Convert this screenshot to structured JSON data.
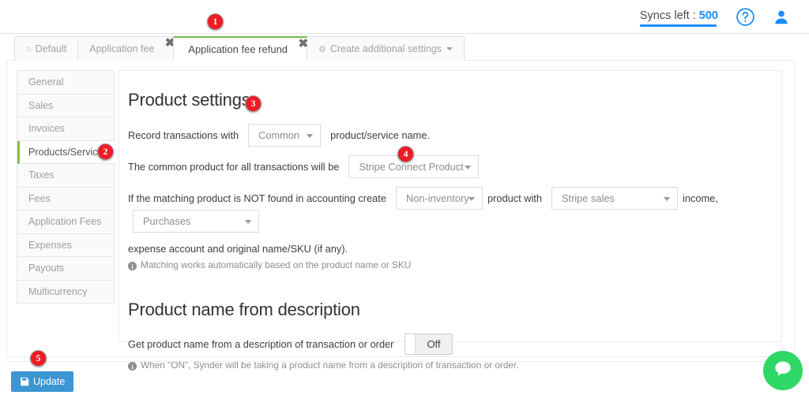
{
  "header": {
    "syncs_label": "Syncs left : ",
    "syncs_value": "500",
    "help_icon": "question-circle-icon",
    "user_icon": "user-avatar-icon",
    "accent_blue": "#1a8cff"
  },
  "tabs": [
    {
      "label": "Default",
      "icon": "home-icon",
      "closable": false,
      "active": false
    },
    {
      "label": "Application fee",
      "icon": "",
      "closable": true,
      "active": false
    },
    {
      "label": "Application fee refund",
      "icon": "",
      "closable": true,
      "active": true
    },
    {
      "label": "Create additional settings",
      "icon": "gear-icon",
      "closable": false,
      "active": false,
      "caret": true
    }
  ],
  "tab_close_glyph": "✖",
  "sidebar": {
    "items": [
      {
        "label": "General",
        "active": false
      },
      {
        "label": "Sales",
        "active": false
      },
      {
        "label": "Invoices",
        "active": false
      },
      {
        "label": "Products/Services",
        "active": true
      },
      {
        "label": "Taxes",
        "active": false
      },
      {
        "label": "Fees",
        "active": false
      },
      {
        "label": "Application Fees",
        "active": false
      },
      {
        "label": "Expenses",
        "active": false
      },
      {
        "label": "Payouts",
        "active": false
      },
      {
        "label": "Multicurrency",
        "active": false
      }
    ],
    "active_accent": "#7cc242"
  },
  "product_settings": {
    "heading": "Product settings",
    "row1": {
      "pre": "Record transactions with",
      "select_value": "Common",
      "post": "product/service name."
    },
    "row2": {
      "pre": "The common product for all transactions will be",
      "select_value": "Stripe Connect Product"
    },
    "row3": {
      "pre": "If the matching product is NOT found in accounting create",
      "type_select": "Non-inventory",
      "mid1": "product with",
      "income_select": "Stripe sales",
      "mid2": "income,",
      "account_select": "Purchases",
      "line2": "expense account and original name/SKU (if any)."
    },
    "hint": "Matching works automatically based on the product name or SKU"
  },
  "product_name_section": {
    "heading": "Product name from description",
    "toggle_label_text": "Get product name from a description of transaction or order",
    "toggle_state": "Off",
    "hint": "When \"ON\", Synder will be taking a product name from a description of transaction or order."
  },
  "footer": {
    "update_label": "Update",
    "update_icon": "save-floppy-icon",
    "update_color": "#3c96d4"
  },
  "chat_widget": {
    "icon": "chat-bubble-icon",
    "color": "#2fd866"
  },
  "markers": [
    {
      "id": "1",
      "value": "1"
    },
    {
      "id": "2",
      "value": "2"
    },
    {
      "id": "3",
      "value": "3"
    },
    {
      "id": "4",
      "value": "4"
    },
    {
      "id": "5",
      "value": "5"
    }
  ]
}
